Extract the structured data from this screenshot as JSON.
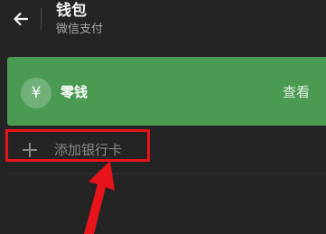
{
  "header": {
    "title": "钱包",
    "subtitle": "微信支付",
    "back_icon": "arrow-left-icon"
  },
  "change_card": {
    "icon_symbol": "¥",
    "label": "零钱",
    "action_label": "查看",
    "background_color": "#4a9a52"
  },
  "add_bank": {
    "icon": "plus-icon",
    "label": "添加银行卡"
  },
  "annotation": {
    "highlight_color": "#e8141c",
    "arrow_icon": "red-arrow-pointer-icon"
  }
}
